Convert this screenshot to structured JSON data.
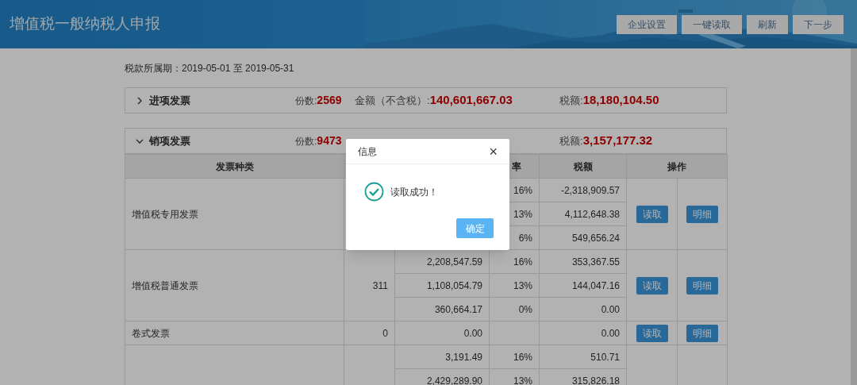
{
  "header": {
    "title": "增值税一般纳税人申报",
    "buttons": [
      "企业设置",
      "一键读取",
      "刷新",
      "下一步"
    ]
  },
  "period": "税款所属期：2019-05-01 至 2019-05-31",
  "sections": [
    {
      "title": "进项发票",
      "expanded": false,
      "count_label": "份数:",
      "count": "2569",
      "amount_label": "金额（不含税）:",
      "amount": "140,601,667.03",
      "tax_label": "税额:",
      "tax": "18,180,104.50"
    },
    {
      "title": "销项发票",
      "expanded": true,
      "count_label": "份数:",
      "count": "9473",
      "tax_label": "税额:",
      "tax": "3,157,177.32"
    }
  ],
  "table": {
    "headers": {
      "type": "发票种类",
      "rate": "率",
      "tax": "税额",
      "actions": "操作"
    },
    "groups": [
      {
        "type": "增值税专用发票",
        "lines": [
          {
            "rate": "16%",
            "tax": "-2,318,909.57"
          },
          {
            "rate": "13%",
            "tax": "4,112,648.38"
          },
          {
            "rate": "6%",
            "tax": "549,656.24"
          }
        ],
        "actions": [
          "读取",
          "明细"
        ]
      },
      {
        "type": "增值税普通发票",
        "count": "311",
        "lines": [
          {
            "amount": "2,208,547.59",
            "rate": "16%",
            "tax": "353,367.55"
          },
          {
            "amount": "1,108,054.79",
            "rate": "13%",
            "tax": "144,047.16"
          },
          {
            "amount": "360,664.17",
            "rate": "0%",
            "tax": "0.00"
          }
        ],
        "actions": [
          "读取",
          "明细"
        ]
      },
      {
        "type": "卷式发票",
        "count": "0",
        "lines": [
          {
            "amount": "0.00",
            "tax": "0.00"
          }
        ],
        "actions": [
          "读取",
          "明细"
        ]
      },
      {
        "lines": [
          {
            "amount": "3,191.49",
            "rate": "16%",
            "tax": "510.71"
          },
          {
            "amount": "2,429,289.90",
            "rate": "13%",
            "tax": "315,826.18"
          }
        ]
      }
    ]
  },
  "dialog": {
    "title": "信息",
    "close": "×",
    "message": "读取成功！",
    "button": "确定"
  }
}
